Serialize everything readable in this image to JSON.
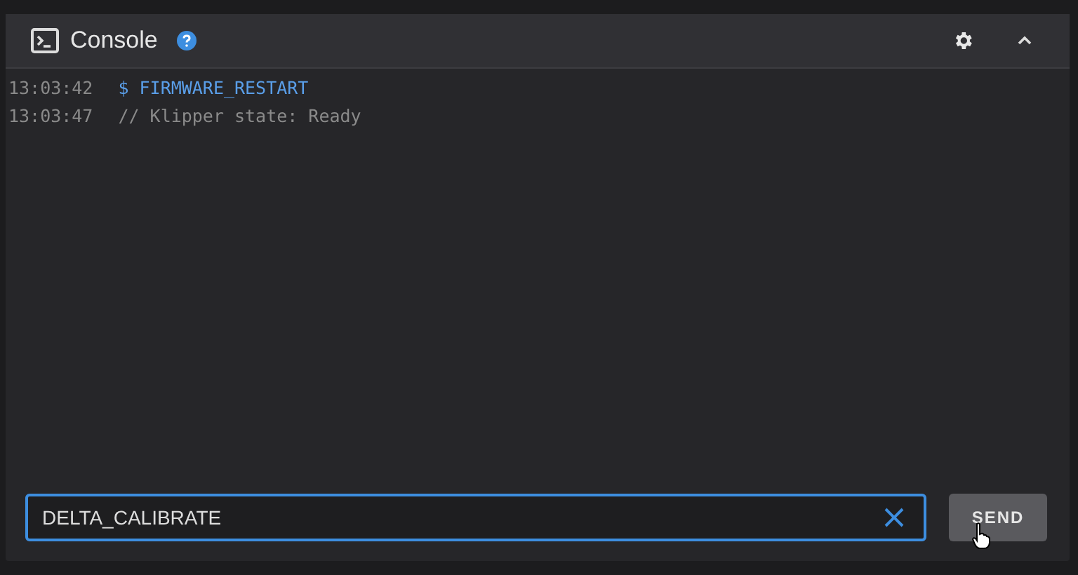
{
  "panel": {
    "title": "Console",
    "help": true,
    "expanded": true
  },
  "lines": [
    {
      "time": "13:03:42",
      "kind": "command",
      "text": "$ FIRMWARE_RESTART"
    },
    {
      "time": "13:03:47",
      "kind": "response",
      "text": "// Klipper state: Ready"
    }
  ],
  "input": {
    "value": "DELTA_CALIBRATE",
    "focused": true
  },
  "send_button": "SEND"
}
